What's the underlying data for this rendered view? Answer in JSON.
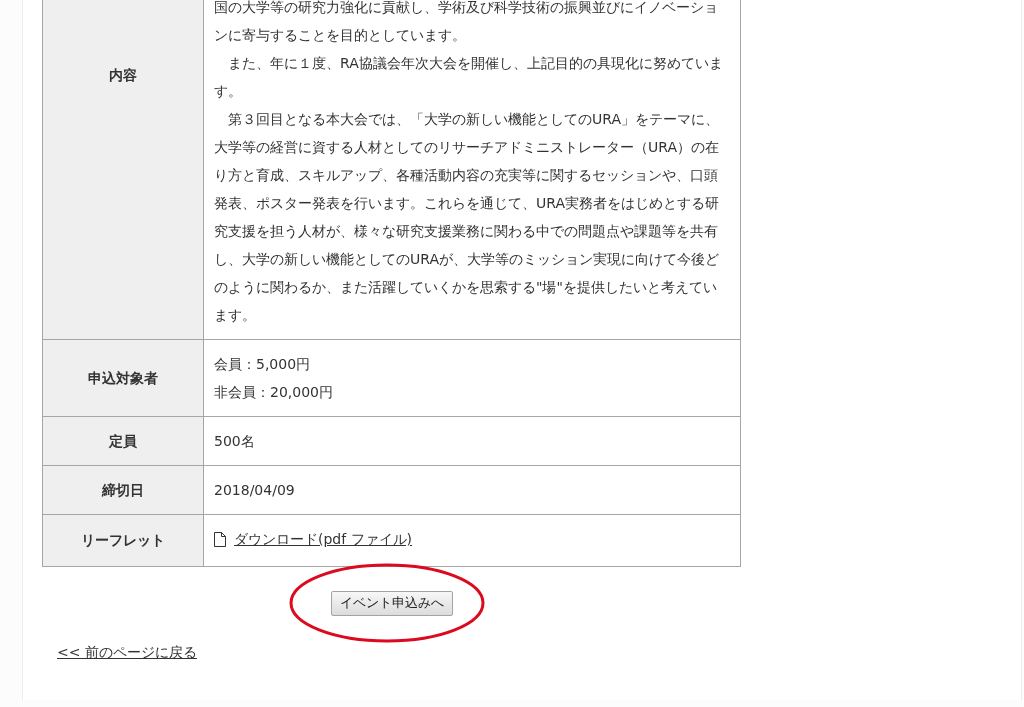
{
  "details_table": {
    "rows": [
      {
        "label": "内容",
        "kind": "paragraphs",
        "paragraphs": [
          "国の大学等の研究力強化に貢献し、学術及び科学技術の振興並びにイノベーションに寄与することを目的としています。",
          "　また、年に１度、RA協議会年次大会を開催し、上記目的の具現化に努めています。",
          "　第３回目となる本大会では、「大学の新しい機能としてのURA」をテーマに、大学等の経営に資する人材としてのリサーチアドミニストレーター（URA）の在り方と育成、スキルアップ、各種活動内容の充実等に関するセッションや、口頭発表、ポスター発表を行います。これらを通じて、URA実務者をはじめとする研究支援を担う人材が、様々な研究支援業務に関わる中での問題点や課題等を共有し、大学の新しい機能としてのURAが、大学等のミッション実現に向けて今後どのように関わるか、また活躍していくかを思索する\"場\"を提供したいと考えています。"
        ]
      },
      {
        "label": "申込対象者",
        "kind": "lines",
        "lines": [
          "会員：5,000円",
          "非会員：20,000円"
        ]
      },
      {
        "label": "定員",
        "kind": "text",
        "value": "500名"
      },
      {
        "label": "締切日",
        "kind": "text",
        "value": "2018/04/09"
      },
      {
        "label": "リーフレット",
        "kind": "file_link",
        "value": "ダウンロード(pdf ファイル)"
      }
    ]
  },
  "apply_button": {
    "label": "イベント申込みへ",
    "highlighted": true
  },
  "back_link": "<< 前のページに戻る"
}
